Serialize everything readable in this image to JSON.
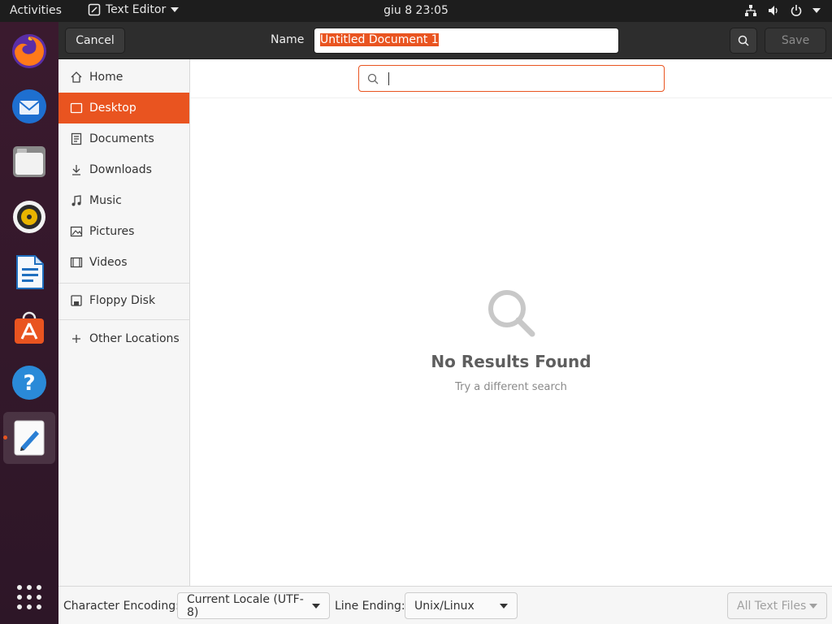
{
  "topbar": {
    "activities": "Activities",
    "app_name": "Text Editor",
    "clock": "giu 8  23:05",
    "tray_icons": [
      "network-icon",
      "volume-icon",
      "power-icon"
    ]
  },
  "dock": {
    "apps": [
      "Firefox",
      "Thunderbird",
      "Files",
      "Rhythmbox",
      "LibreOffice Writer",
      "Ubuntu Software",
      "Help",
      "Text Editor"
    ],
    "active_app": "Text Editor"
  },
  "header": {
    "cancel_label": "Cancel",
    "name_label": "Name",
    "name_value": "Untitled Document 1",
    "save_label": "Save"
  },
  "sidebar": {
    "items": [
      {
        "label": "Home",
        "icon": "home-icon"
      },
      {
        "label": "Desktop",
        "icon": "desktop-icon",
        "selected": true
      },
      {
        "label": "Documents",
        "icon": "documents-icon"
      },
      {
        "label": "Downloads",
        "icon": "downloads-icon"
      },
      {
        "label": "Music",
        "icon": "music-icon"
      },
      {
        "label": "Pictures",
        "icon": "pictures-icon"
      },
      {
        "label": "Videos",
        "icon": "videos-icon"
      },
      {
        "label": "Floppy Disk",
        "icon": "floppy-icon"
      },
      {
        "label": "Other Locations",
        "icon": "plus-icon"
      }
    ]
  },
  "search": {
    "value": "",
    "empty_title": "No Results Found",
    "empty_subtitle": "Try a different search"
  },
  "footer": {
    "encoding_label": "Character Encoding:",
    "encoding_value": "Current Locale (UTF-8)",
    "line_ending_label": "Line Ending:",
    "line_ending_value": "Unix/Linux",
    "filter_value": "All Text Files"
  },
  "colors": {
    "accent": "#e95420",
    "dock_bg": "#2d1627",
    "header_bg": "#2d2d2d"
  }
}
